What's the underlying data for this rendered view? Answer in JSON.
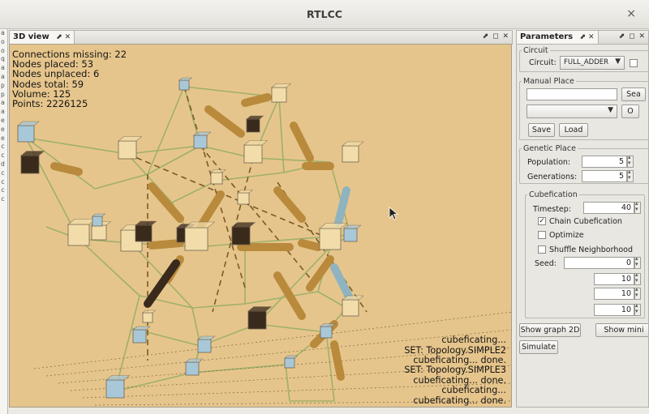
{
  "window": {
    "title": "RTLCC",
    "close_glyph": "×"
  },
  "left_strip_letters": [
    "a",
    "o",
    "o",
    "q",
    "a",
    "a",
    "p",
    "p",
    "a",
    "a",
    "e",
    "e",
    "e",
    "c",
    "c",
    "d",
    "c",
    "c",
    "c",
    "c"
  ],
  "view_panel": {
    "tab_label": "3D view",
    "tab_icons": "⬈ ✕",
    "controls": "⬈ ◻ ✕",
    "stats": {
      "connections_missing": "Connections missing: 22",
      "nodes_placed": "Nodes placed: 53",
      "nodes_unplaced": "Nodes unplaced: 6",
      "nodes_total": "Nodes total: 59",
      "volume": "Volume: 125",
      "points": "Points: 2226125"
    },
    "log_lines": [
      "cubeficating...",
      "SET: Topology.SIMPLE2",
      "cubeficating... done.",
      "SET: Topology.SIMPLE3",
      "cubeficating... done.",
      "cubeficating...",
      "cubeficating... done."
    ],
    "colors": {
      "background": "#e6c58c",
      "edge": "#9fb06a",
      "dashed": "#7a5a25",
      "cube_light": "#f2ddaa",
      "cube_blue": "#a8c8d8",
      "cube_dark": "#3a2a1c",
      "cylinder_gold": "#b98a3c",
      "cylinder_blue": "#8fb4c0"
    }
  },
  "params_panel": {
    "tab_label": "Parameters",
    "tab_icons": "⬈ ✕",
    "controls": "⬈ ◻ ✕",
    "circuit": {
      "legend": "Circuit",
      "label": "Circuit:",
      "value": "FULL_ADDER"
    },
    "manual_place": {
      "legend": "Manual Place",
      "search_value": "",
      "search_button": "Sea",
      "select_value": "",
      "open_button": "O",
      "save_button": "Save",
      "load_button": "Load"
    },
    "genetic_place": {
      "legend": "Genetic Place",
      "population_label": "Population:",
      "population_value": "5",
      "generations_label": "Generations:",
      "generations_value": "5"
    },
    "cubefication": {
      "legend": "Cubefication",
      "timestep_label": "Timestep:",
      "timestep_value": "40",
      "chain_label": "Chain Cubefication",
      "chain_checked": true,
      "optimize_label": "Optimize",
      "optimize_checked": false,
      "shuffle_label": "Shuffle Neighborhood",
      "shuffle_checked": false,
      "seed_label": "Seed:",
      "seed_value": "0",
      "extra_values": [
        "10",
        "10",
        "10"
      ]
    },
    "show_graph_button": "Show graph 2D",
    "show_mini_button": "Show mini",
    "simulate_button": "Simulate"
  }
}
